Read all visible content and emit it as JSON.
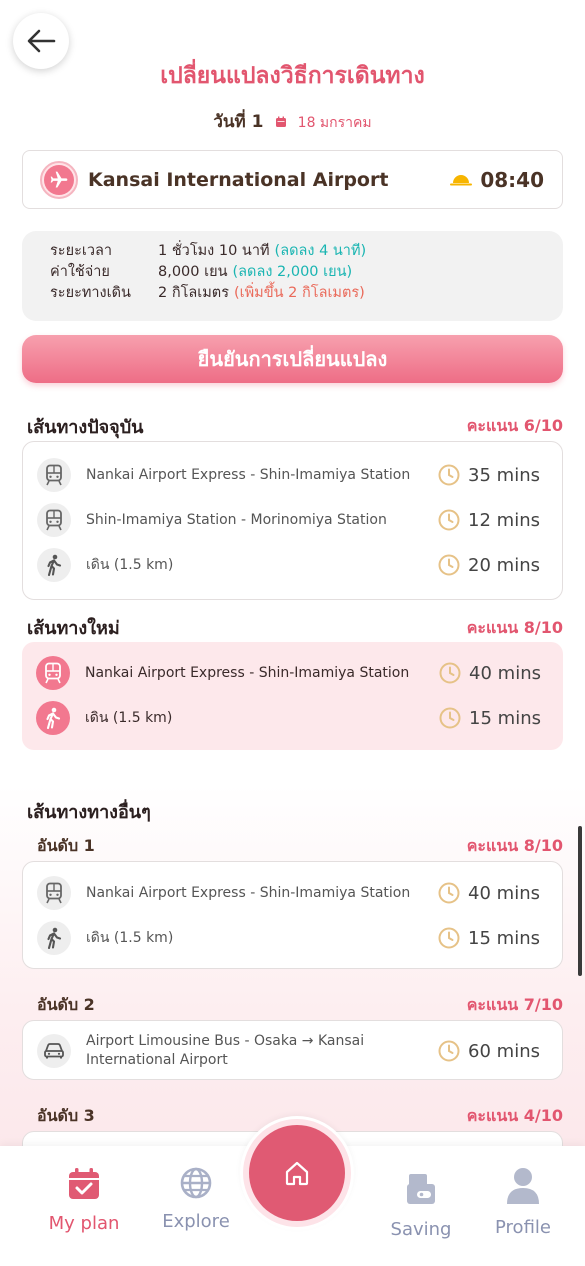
{
  "header": {
    "title": "เปลี่ยนแปลงวิธีการเดินทาง",
    "day_label": "วันที่ 1",
    "date": "18 มกราคม"
  },
  "origin": {
    "name": "Kansai International Airport",
    "time": "08:40",
    "icon": "airplane-icon",
    "weather_icon": "sun-icon"
  },
  "summary": {
    "rows": [
      {
        "label": "ระยะเวลา",
        "value": "1 ชั่วโมง 10 นาที",
        "delta": "(ลดลง 4 นาที)",
        "delta_color": "#1ab5b2"
      },
      {
        "label": "ค่าใช้จ่าย",
        "value": "8,000 เยน",
        "delta": "(ลดลง 2,000 เยน)",
        "delta_color": "#1ab5b2"
      },
      {
        "label": "ระยะทางเดิน",
        "value": "2 กิโลเมตร",
        "delta": "(เพิ่มขึ้น 2 กิโลเมตร)",
        "delta_color": "#ea6a5a"
      }
    ]
  },
  "confirm_button": "ยืนยันการเปลี่ยนแปลง",
  "current_route": {
    "title": "เส้นทางปัจจุบัน",
    "score": "คะแนน 6/10",
    "steps": [
      {
        "icon": "train-icon",
        "text": "Nankai Airport Express - Shin-Imamiya Station",
        "duration": "35 mins"
      },
      {
        "icon": "train-icon",
        "text": "Shin-Imamiya Station - Morinomiya Station",
        "duration": "12 mins"
      },
      {
        "icon": "walk-icon",
        "text": "เดิน (1.5 km)",
        "duration": "20 mins"
      }
    ]
  },
  "new_route": {
    "title": "เส้นทางใหม่",
    "score": "คะแนน 8/10",
    "steps": [
      {
        "icon": "train-icon",
        "text": "Nankai Airport Express - Shin-Imamiya Station",
        "duration": "40 mins"
      },
      {
        "icon": "walk-icon",
        "text": "เดิน (1.5 km)",
        "duration": "15 mins"
      }
    ]
  },
  "other_routes": {
    "title": "เส้นทางทางอื่นๆ",
    "ranks": [
      {
        "title": "อันดับ 1",
        "score": "คะแนน 8/10",
        "steps": [
          {
            "icon": "train-icon",
            "text": "Nankai Airport Express - Shin-Imamiya Station",
            "duration": "40 mins"
          },
          {
            "icon": "walk-icon",
            "text": "เดิน (1.5 km)",
            "duration": "15 mins"
          }
        ]
      },
      {
        "title": "อันดับ 2",
        "score": "คะแนน 7/10",
        "steps": [
          {
            "icon": "car-icon",
            "text": "Airport Limousine Bus - Osaka → Kansai International Airport",
            "duration": "60 mins"
          }
        ]
      },
      {
        "title": "อันดับ 3",
        "score": "คะแนน 4/10"
      }
    ]
  },
  "nav": {
    "items": [
      {
        "label": "My plan",
        "icon": "calendar-check-icon",
        "active": true
      },
      {
        "label": "Explore",
        "icon": "globe-icon",
        "active": false
      },
      {
        "label": "",
        "icon": "home-icon",
        "active": false
      },
      {
        "label": "Saving",
        "icon": "wallet-icon",
        "active": false
      },
      {
        "label": "Profile",
        "icon": "user-icon",
        "active": false
      }
    ]
  },
  "colors": {
    "accent": "#e2566f",
    "teal": "#1ab5b2",
    "pink_bg": "#fde8eb"
  }
}
